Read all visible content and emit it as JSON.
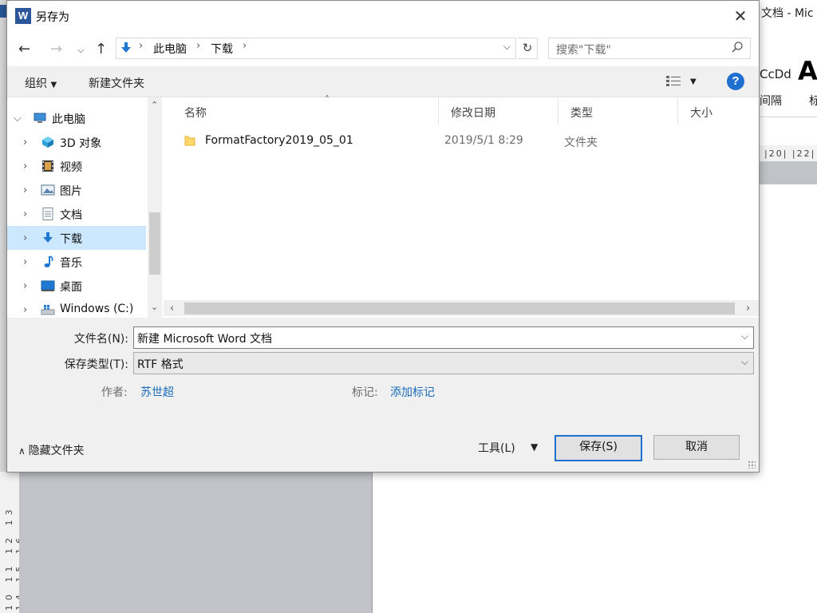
{
  "background_app": {
    "title": "文档 - Mic",
    "style_sample_1": "CcDd",
    "style_sample_2": "A",
    "ribbon_label_1": "间隔",
    "ribbon_label_2": "标",
    "ruler_ticks": "|20| |22|",
    "vertical_ruler_ticks": "10 11 12 13 14 15 16"
  },
  "dialog": {
    "title": "另存为",
    "app_icon_letter": "W",
    "close_glyph": "✕"
  },
  "navigation": {
    "breadcrumbs": [
      "此电脑",
      "下载"
    ],
    "search_placeholder": "搜索\"下载\""
  },
  "toolbar": {
    "organize_label": "组织",
    "new_folder_label": "新建文件夹",
    "help_glyph": "?"
  },
  "nav_tree": {
    "root": "此电脑",
    "items": [
      {
        "label": "3D 对象",
        "icon": "3d-objects-icon"
      },
      {
        "label": "视频",
        "icon": "video-icon"
      },
      {
        "label": "图片",
        "icon": "pictures-icon"
      },
      {
        "label": "文档",
        "icon": "documents-icon"
      },
      {
        "label": "下载",
        "icon": "downloads-icon",
        "selected": true
      },
      {
        "label": "音乐",
        "icon": "music-icon"
      },
      {
        "label": "桌面",
        "icon": "desktop-icon"
      },
      {
        "label": "Windows (C:)",
        "icon": "drive-icon"
      }
    ]
  },
  "file_list": {
    "columns": [
      "名称",
      "修改日期",
      "类型",
      "大小"
    ],
    "rows": [
      {
        "name": "FormatFactory2019_05_01",
        "modified": "2019/5/1 8:29",
        "type": "文件夹",
        "size": ""
      }
    ]
  },
  "form": {
    "filename_label": "文件名(N):",
    "filename_value": "新建 Microsoft Word 文档",
    "filetype_label": "保存类型(T):",
    "filetype_value": "RTF 格式",
    "author_label": "作者:",
    "author_value": "苏世超",
    "tags_label": "标记:",
    "tags_value": "添加标记"
  },
  "footer": {
    "hide_folders_label": "隐藏文件夹",
    "tools_label": "工具(L)",
    "save_label": "保存(S)",
    "cancel_label": "取消"
  },
  "colors": {
    "accent": "#1f6fd1",
    "selection": "#cce8ff",
    "link": "#1a6cb8",
    "word_blue": "#2b579a"
  }
}
